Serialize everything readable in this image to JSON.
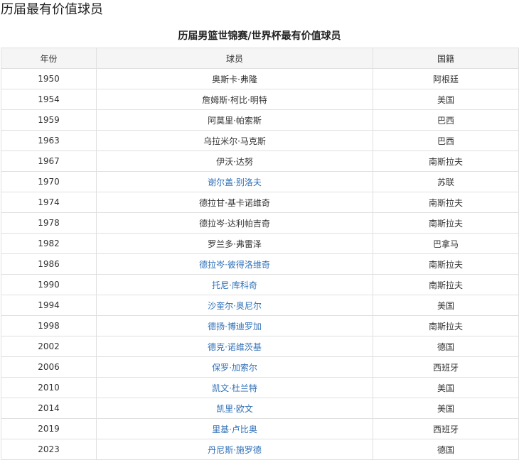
{
  "page": {
    "title": "历届最有价值球员"
  },
  "table": {
    "caption": "历届男篮世锦赛/世界杯最有价值球员",
    "headers": {
      "year": "年份",
      "player": "球员",
      "nation": "国籍"
    },
    "link_color": "#2e6fb7",
    "rows": [
      {
        "year": "1950",
        "player": "奥斯卡·弗隆",
        "nation": "阿根廷",
        "linked": false
      },
      {
        "year": "1954",
        "player": "詹姆斯·柯比·明特",
        "nation": "美国",
        "linked": false
      },
      {
        "year": "1959",
        "player": "阿莫里·帕索斯",
        "nation": "巴西",
        "linked": false
      },
      {
        "year": "1963",
        "player": "乌拉米尔·马克斯",
        "nation": "巴西",
        "linked": false
      },
      {
        "year": "1967",
        "player": "伊沃·达努",
        "nation": "南斯拉夫",
        "linked": false
      },
      {
        "year": "1970",
        "player": "谢尔盖·别洛夫",
        "nation": "苏联",
        "linked": true
      },
      {
        "year": "1974",
        "player": "德拉甘·基卡诺维奇",
        "nation": "南斯拉夫",
        "linked": false
      },
      {
        "year": "1978",
        "player": "德拉岑·达利帕吉奇",
        "nation": "南斯拉夫",
        "linked": false
      },
      {
        "year": "1982",
        "player": "罗兰多·弗雷泽",
        "nation": "巴拿马",
        "linked": false
      },
      {
        "year": "1986",
        "player": "德拉岑·彼得洛维奇",
        "nation": "南斯拉夫",
        "linked": true
      },
      {
        "year": "1990",
        "player": "托尼·库科奇",
        "nation": "南斯拉夫",
        "linked": true
      },
      {
        "year": "1994",
        "player": "沙奎尔·奥尼尔",
        "nation": "美国",
        "linked": true
      },
      {
        "year": "1998",
        "player": "德扬·博迪罗加",
        "nation": "南斯拉夫",
        "linked": true
      },
      {
        "year": "2002",
        "player": "德克·诺维茨基",
        "nation": "德国",
        "linked": true
      },
      {
        "year": "2006",
        "player": "保罗·加索尔",
        "nation": "西班牙",
        "linked": true
      },
      {
        "year": "2010",
        "player": "凯文·杜兰特",
        "nation": "美国",
        "linked": true
      },
      {
        "year": "2014",
        "player": "凯里·欧文",
        "nation": "美国",
        "linked": true
      },
      {
        "year": "2019",
        "player": "里基·卢比奥",
        "nation": "西班牙",
        "linked": true
      },
      {
        "year": "2023",
        "player": "丹尼斯·施罗德",
        "nation": "德国",
        "linked": true
      }
    ]
  }
}
